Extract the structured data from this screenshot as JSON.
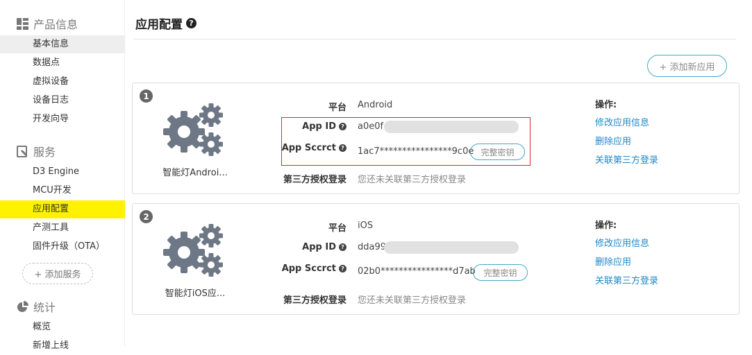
{
  "sidebar": {
    "product_section": {
      "title": "产品信息",
      "icon": "grid-icon"
    },
    "product_items": [
      "基本信息",
      "数据点",
      "虚拟设备",
      "设备日志",
      "开发向导"
    ],
    "service_section": {
      "title": "服务",
      "icon": "wrench-icon"
    },
    "service_items": [
      "D3 Engine",
      "MCU开发",
      "应用配置",
      "产测工具",
      "固件升级（OTA）"
    ],
    "add_service": "+ 添加服务",
    "stats_section": {
      "title": "统计",
      "icon": "pie-chart-icon"
    },
    "stats_items": [
      "概览",
      "新增上线"
    ]
  },
  "main": {
    "title": "应用配置",
    "title_help_icon": "?",
    "add_app_button": "+ 添加新应用",
    "labels": {
      "platform": "平台",
      "app_id": "App ID",
      "app_secret": "App Sccrct",
      "third_party": "第三方授权登录"
    },
    "operations_title": "操作:",
    "operations": [
      "修改应用信息",
      "删除应用",
      "关联第三方登录"
    ],
    "full_key_button": "完整密钥",
    "apps": [
      {
        "index": "1",
        "name": "智能灯Androi...",
        "platform": "Android",
        "app_id_prefix": "a0e0f",
        "secret": "1ac7****************9c0e",
        "third_party_status": "您还未关联第三方授权登录"
      },
      {
        "index": "2",
        "name": "智能灯iOS应...",
        "platform": "iOS",
        "app_id_prefix": "dda99",
        "secret": "02b0****************d7ab",
        "third_party_status": "您还未关联第三方授权登录"
      }
    ]
  },
  "colors": {
    "active_nav": "#fff200",
    "selected_nav": "#eeeeee",
    "accent_border": "#44a7c2",
    "link": "#1e88c7",
    "highlight_box": "#d9262a"
  }
}
